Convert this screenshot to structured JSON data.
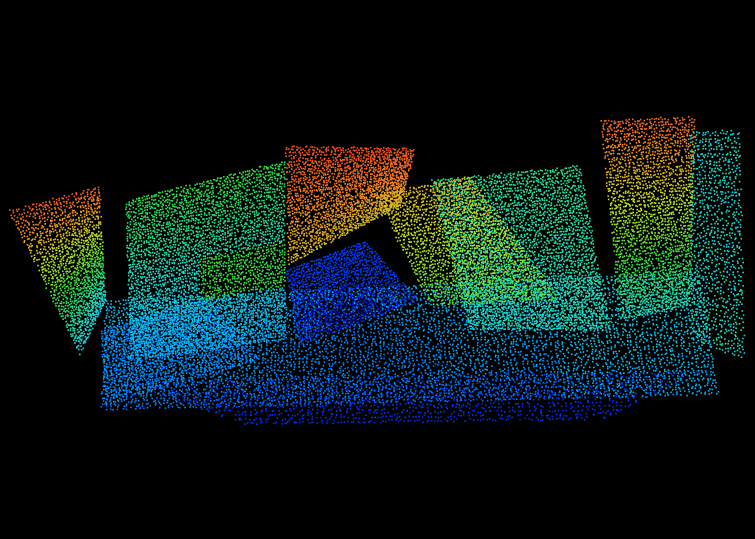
{
  "scene": {
    "subject": "point-cloud",
    "colormap": "jet",
    "background_color": "#000000",
    "colormap_stops": [
      "#0000a0",
      "#0030ff",
      "#00b0ff",
      "#20e0d0",
      "#30e040",
      "#c8e820",
      "#ff8020",
      "#e83020"
    ],
    "point_count_estimate": 20000
  }
}
